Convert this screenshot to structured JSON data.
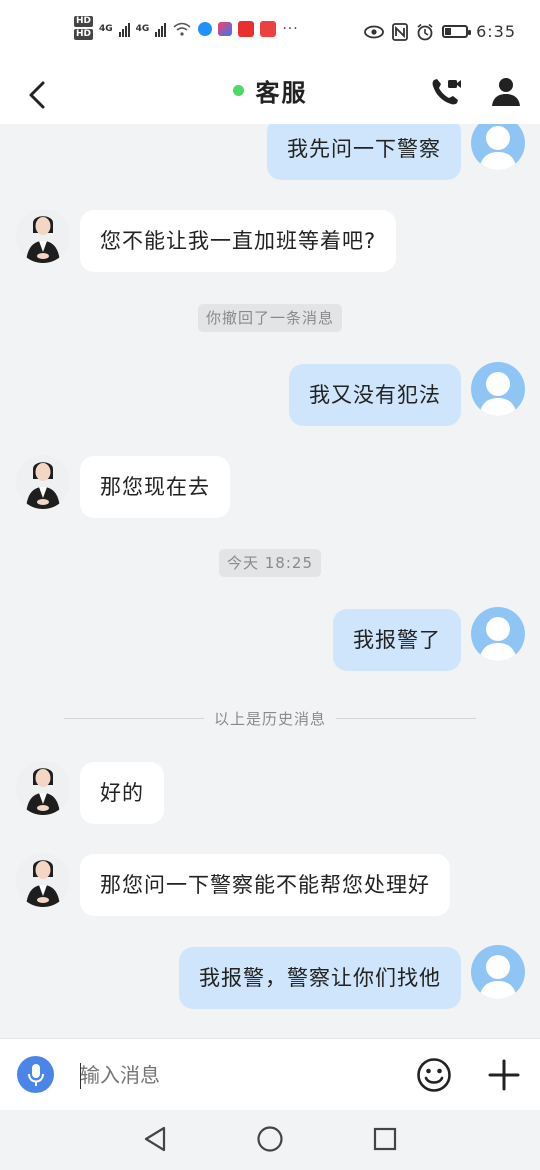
{
  "status_bar": {
    "hd1": "HD",
    "hd2": "HD",
    "net1": "4G",
    "net2": "4G",
    "time": "6:35",
    "battery_level": 0.25,
    "icons": [
      "hd-icon",
      "signal-icon",
      "wifi-icon",
      "app-icon",
      "app-icon",
      "app-icon",
      "app-icon",
      "more-icon",
      "eye-icon",
      "nfc-icon",
      "alarm-icon",
      "battery-icon"
    ]
  },
  "header": {
    "title": "客服",
    "online_color": "#4cd964"
  },
  "messages": [
    {
      "side": "out",
      "text": "我先问一下警察"
    },
    {
      "side": "in",
      "text": "您不能让我一直加班等着吧?"
    },
    {
      "type": "notice",
      "text": "你撤回了一条消息"
    },
    {
      "side": "out",
      "text": "我又没有犯法"
    },
    {
      "side": "in",
      "text": "那您现在去"
    },
    {
      "type": "time",
      "text": "今天  18:25"
    },
    {
      "side": "out",
      "text": "我报警了"
    },
    {
      "type": "divider",
      "text": "以上是历史消息"
    },
    {
      "side": "in",
      "text": "好的"
    },
    {
      "side": "in",
      "text": "那您问一下警察能不能帮您处理好"
    },
    {
      "side": "out",
      "text": "我报警，警察让你们找他"
    }
  ],
  "input_bar": {
    "placeholder": "输入消息"
  },
  "colors": {
    "out_bubble": "#cfe5fb",
    "in_bubble": "#ffffff",
    "accent": "#4a86e8"
  }
}
